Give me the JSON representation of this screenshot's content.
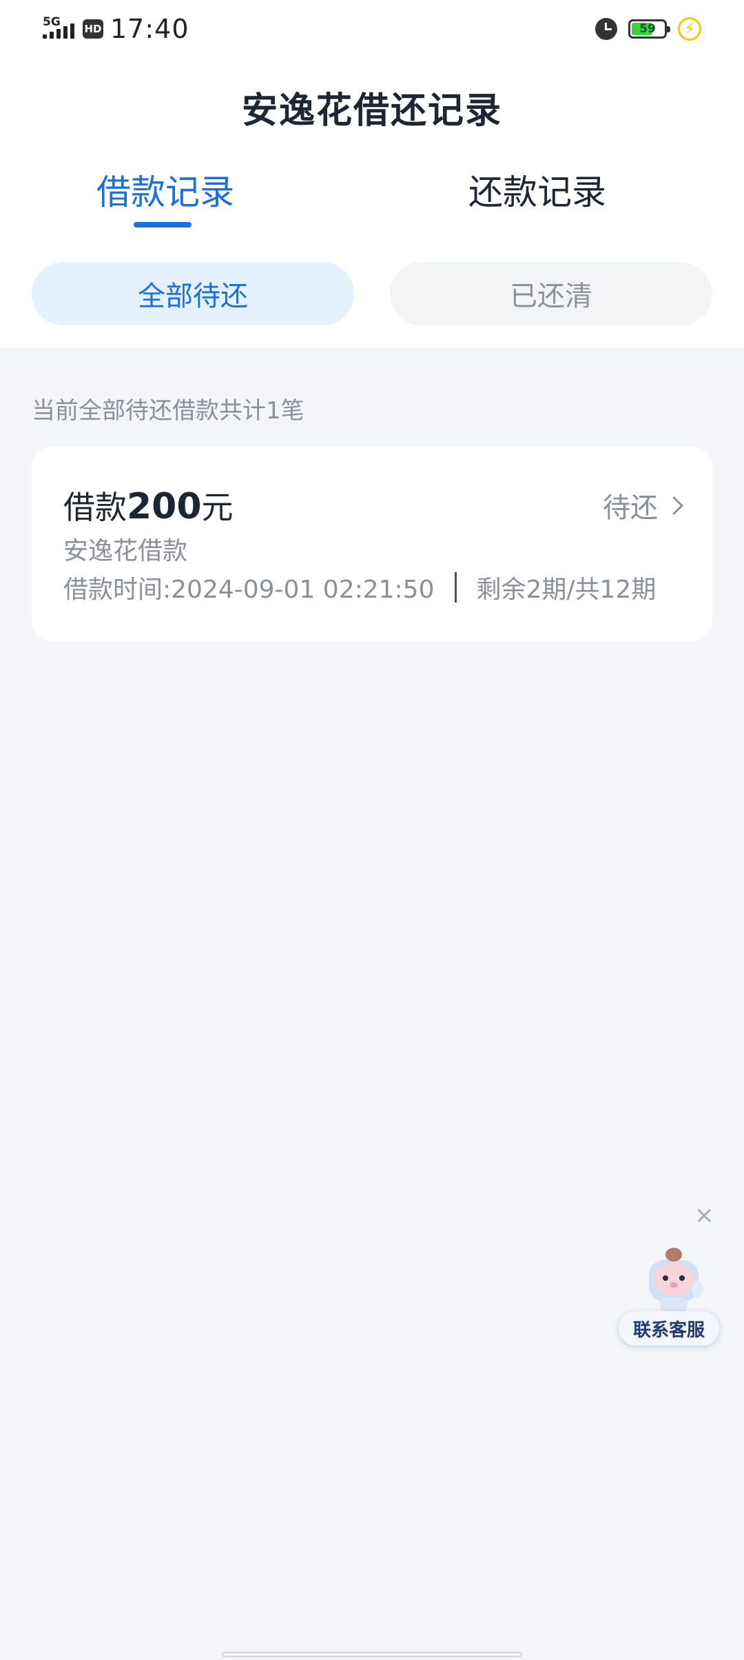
{
  "status_bar": {
    "network": "5G",
    "hd": "HD",
    "time": "17:40",
    "battery": "59"
  },
  "header": {
    "title": "安逸花借还记录"
  },
  "tabs": [
    {
      "label": "借款记录",
      "active": true
    },
    {
      "label": "还款记录",
      "active": false
    }
  ],
  "filters": [
    {
      "label": "全部待还",
      "active": true
    },
    {
      "label": "已还清",
      "active": false
    }
  ],
  "summary": "当前全部待还借款共计1笔",
  "loans": [
    {
      "amount_prefix": "借款",
      "amount": "200",
      "amount_suffix": "元",
      "status": "待还",
      "product": "安逸花借款",
      "time": "借款时间:2024-09-01 02:21:50",
      "installments": "剩余2期/共12期"
    }
  ],
  "float": {
    "close": "×",
    "customer_service": "联系客服"
  },
  "colors": {
    "accent": "#1b6fe0",
    "accent_bg": "#e6f1ff",
    "page_bg": "#f3f5f8"
  }
}
